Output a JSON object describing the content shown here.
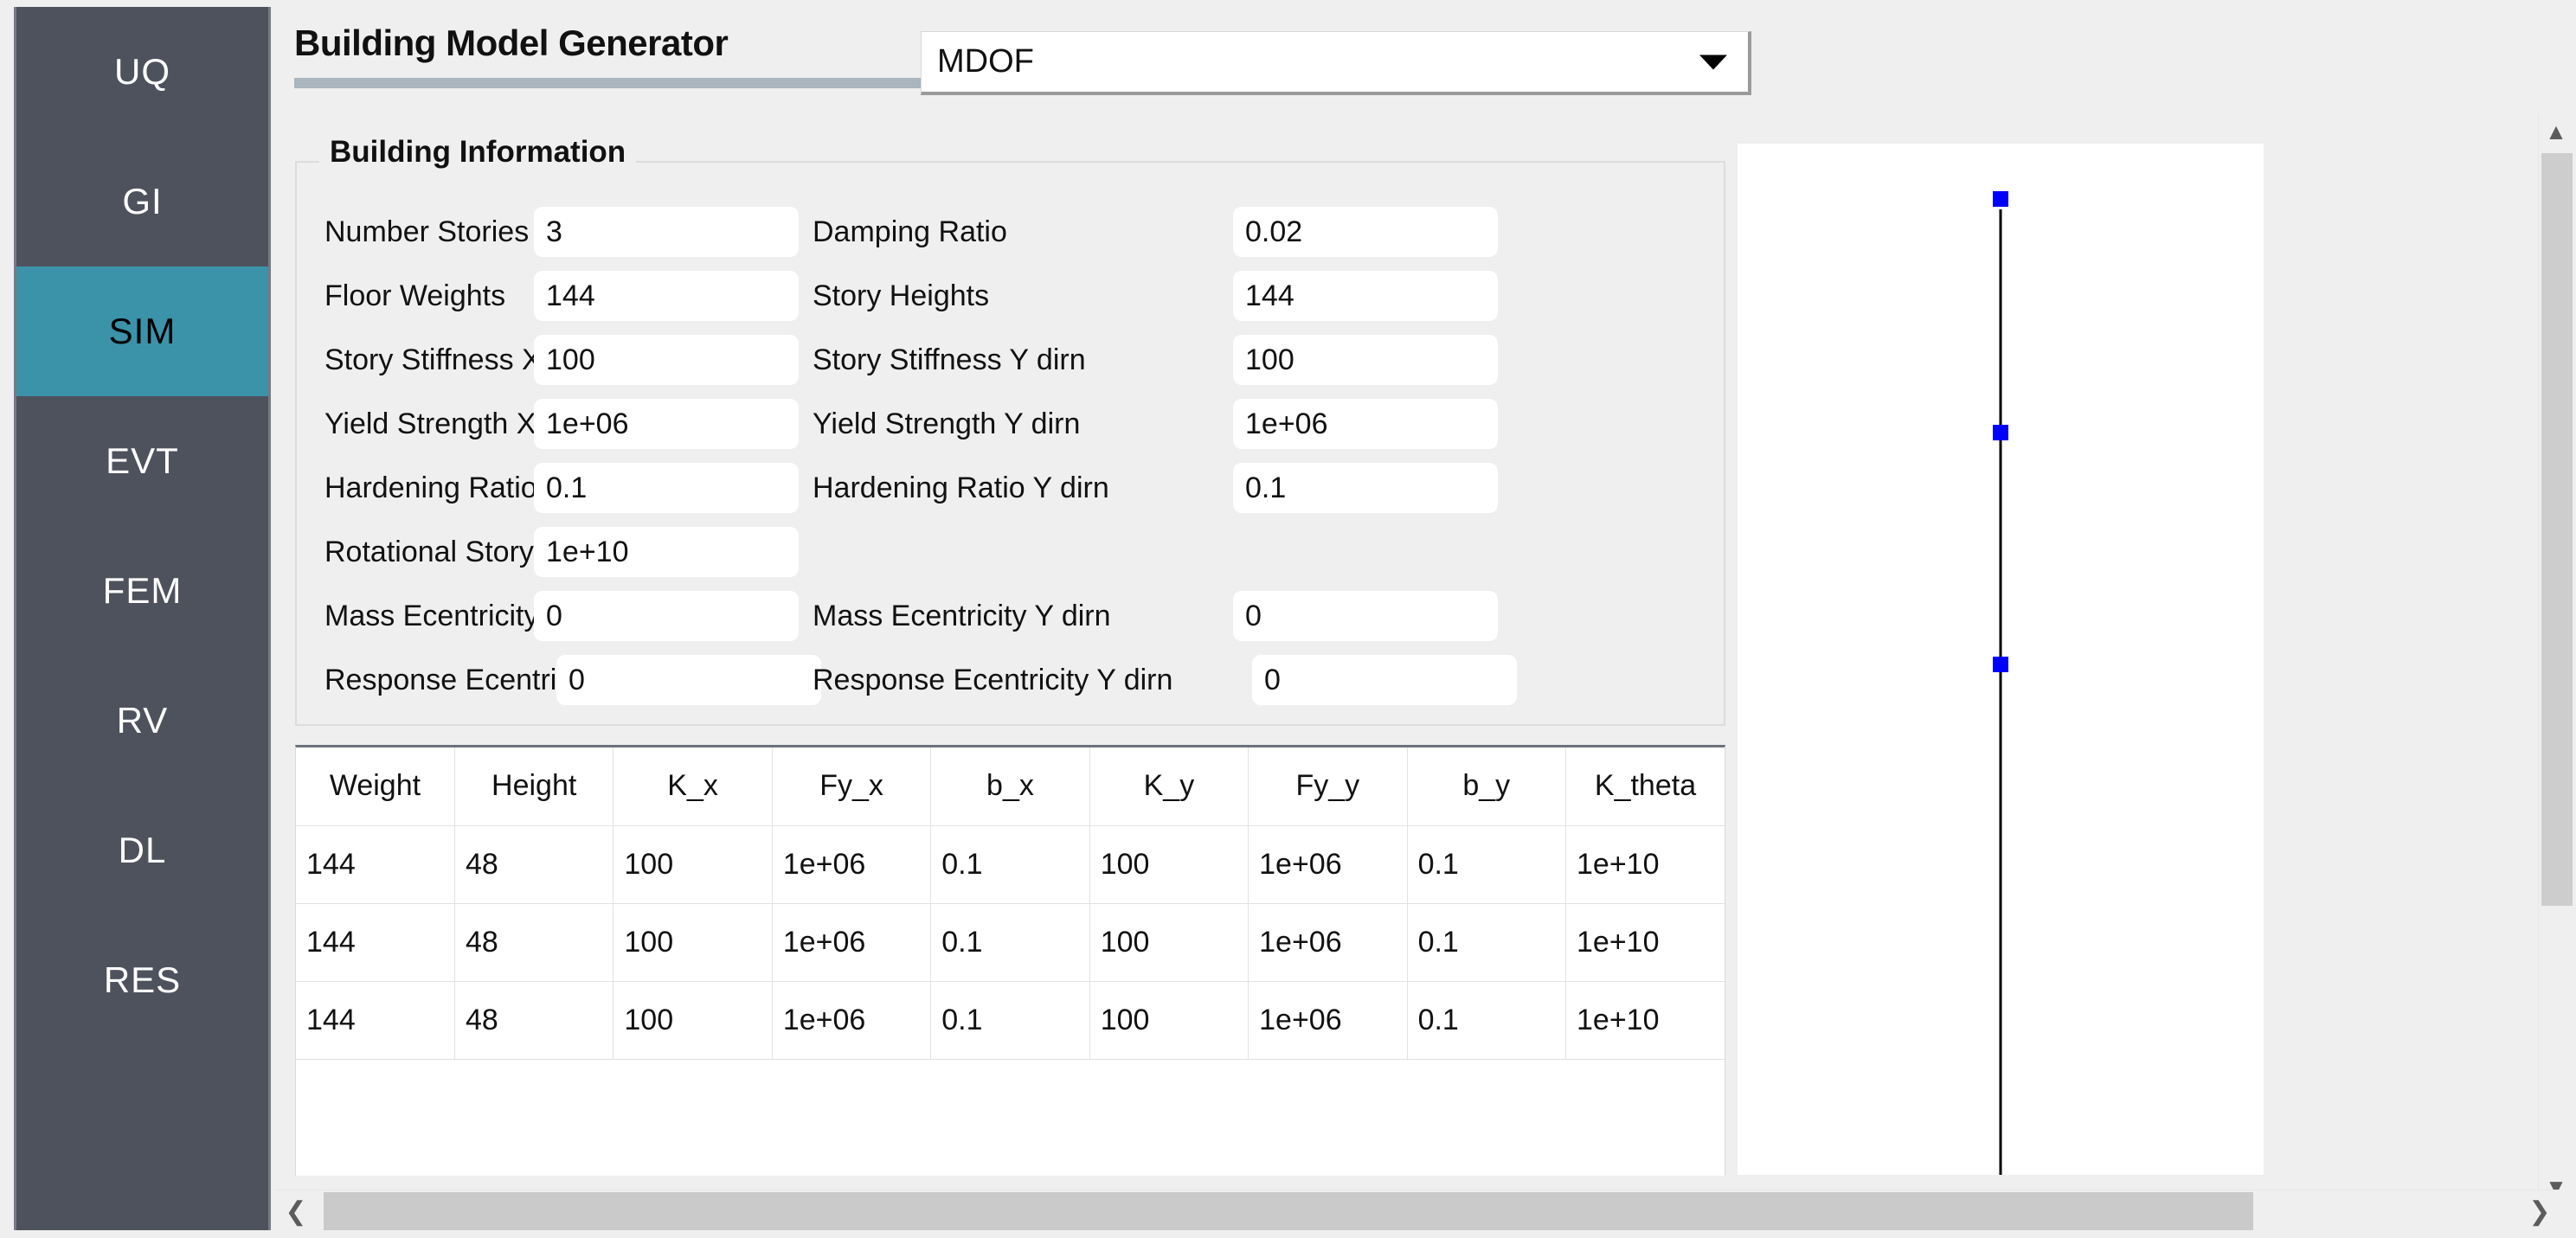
{
  "sidebar": {
    "items": [
      {
        "label": "UQ",
        "active": false
      },
      {
        "label": "GI",
        "active": false
      },
      {
        "label": "SIM",
        "active": true
      },
      {
        "label": "EVT",
        "active": false
      },
      {
        "label": "FEM",
        "active": false
      },
      {
        "label": "RV",
        "active": false
      },
      {
        "label": "DL",
        "active": false
      },
      {
        "label": "RES",
        "active": false
      }
    ],
    "active_color": "#3b93aa",
    "background_color": "#4e525c"
  },
  "header": {
    "title": "Building Model Generator",
    "model_selected": "MDOF",
    "dropdown_icon": "chevron-down-icon"
  },
  "building_information": {
    "legend": "Building Information",
    "fields": [
      {
        "label": "Number Stories",
        "value": "3"
      },
      {
        "label": "Damping Ratio",
        "value": "0.02"
      },
      {
        "label": "Floor Weights",
        "value": "144"
      },
      {
        "label": "Story Heights",
        "value": "144"
      },
      {
        "label": "Story Stiffness X dirn",
        "value": "100"
      },
      {
        "label": "Story Stiffness Y dirn",
        "value": "100"
      },
      {
        "label": "Yield Strength X dirn",
        "value": "1e+06"
      },
      {
        "label": "Yield Strength Y dirn",
        "value": "1e+06"
      },
      {
        "label": "Hardening Ratio X dirn",
        "value": "0.1"
      },
      {
        "label": "Hardening Ratio Y dirn",
        "value": "0.1"
      },
      {
        "label": "Rotational Story Stiffness",
        "value": "1e+10"
      },
      {
        "label": "Mass Ecentricity X dirn",
        "value": "0"
      },
      {
        "label": "Mass Ecentricity Y dirn",
        "value": "0"
      },
      {
        "label": "Response Ecentricity X dirn",
        "value": "0"
      },
      {
        "label": "Response Ecentricity Y dirn",
        "value": "0"
      }
    ]
  },
  "story_table": {
    "columns": [
      "Weight",
      "Height",
      "K_x",
      "Fy_x",
      "b_x",
      "K_y",
      "Fy_y",
      "b_y",
      "K_theta"
    ],
    "rows": [
      [
        "144",
        "48",
        "100",
        "1e+06",
        "0.1",
        "100",
        "1e+06",
        "0.1",
        "1e+10"
      ],
      [
        "144",
        "48",
        "100",
        "1e+06",
        "0.1",
        "100",
        "1e+06",
        "0.1",
        "1e+10"
      ],
      [
        "144",
        "48",
        "100",
        "1e+06",
        "0.1",
        "100",
        "1e+06",
        "0.1",
        "1e+10"
      ]
    ]
  },
  "visualization": {
    "node_color": "#0000ff",
    "column_color": "#000000",
    "node_count": 3,
    "node_positions_pct": [
      0,
      50,
      100
    ]
  },
  "scrollbars": {
    "vertical": {
      "up_icon": "chevron-up-icon",
      "down_icon": "chevron-down-icon"
    },
    "horizontal": {
      "left_icon": "chevron-left-icon",
      "right_icon": "chevron-right-icon"
    }
  }
}
